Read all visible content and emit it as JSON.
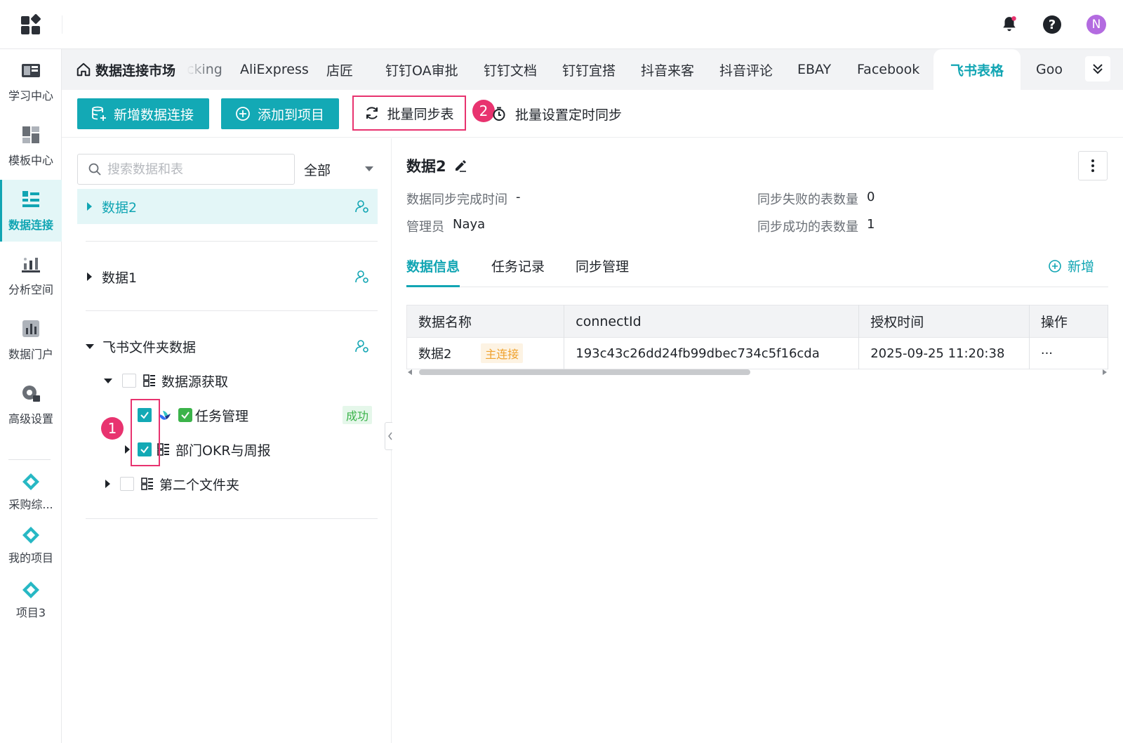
{
  "colors": {
    "accent": "#13a9b5",
    "highlight": "#e8336f",
    "success": "#3bb34a",
    "warning": "#f0a22e"
  },
  "topbar": {
    "icons": [
      "apps-grid-icon",
      "bell-icon",
      "help-icon"
    ],
    "avatar_letter": "N"
  },
  "sidebar": {
    "items": [
      {
        "label": "学习中心",
        "icon": "book-icon"
      },
      {
        "label": "模板中心",
        "icon": "template-icon"
      },
      {
        "label": "数据连接",
        "icon": "data-connect-icon",
        "active": true
      },
      {
        "label": "分析空间",
        "icon": "analysis-icon"
      },
      {
        "label": "数据门户",
        "icon": "bar-chart-icon"
      },
      {
        "label": "高级设置",
        "icon": "gear-icon"
      }
    ],
    "projects": [
      {
        "label": "采购综...",
        "icon": "project-diamond-icon"
      },
      {
        "label": "我的项目",
        "icon": "project-diamond-icon"
      },
      {
        "label": "项目3",
        "icon": "project-diamond-icon"
      }
    ]
  },
  "tabs": {
    "home": "数据连接市场",
    "items": [
      "cking",
      "AliExpress",
      "店匠",
      "钉钉OA审批",
      "钉钉文档",
      "钉钉宜搭",
      "抖音来客",
      "抖音评论",
      "EBAY",
      "Facebook",
      "飞书表格",
      "Goo"
    ],
    "active": "飞书表格"
  },
  "toolbar": {
    "add_connection": "新增数据连接",
    "add_to_project": "添加到项目",
    "batch_sync": "批量同步表",
    "batch_schedule": "批量设置定时同步",
    "step_badges": [
      "1",
      "2"
    ]
  },
  "tree": {
    "search_placeholder": "搜索数据和表",
    "filter": "全部",
    "items": {
      "data2": "数据2",
      "data1": "数据1",
      "feishu_folder": "飞书文件夹数据",
      "source_fetch": "数据源获取",
      "task_mgmt": "任务管理",
      "task_status": "成功",
      "okr": "部门OKR与周报",
      "second_folder": "第二个文件夹"
    }
  },
  "detail": {
    "title": "数据2",
    "sync_time_label": "数据同步完成时间",
    "sync_time_value": "-",
    "admin_label": "管理员",
    "admin_value": "Naya",
    "fail_label": "同步失败的表数量",
    "fail_value": "0",
    "success_label": "同步成功的表数量",
    "success_value": "1",
    "subtabs": [
      "数据信息",
      "任务记录",
      "同步管理"
    ],
    "add_label": "新增",
    "table": {
      "headers": [
        "数据名称",
        "connectId",
        "授权时间",
        "操作"
      ],
      "rows": [
        {
          "name": "数据2",
          "tag": "主连接",
          "connect_id": "193c43c26dd24fb99dbec734c5f16cda",
          "auth_time": "2025-09-25 11:20:38",
          "action": "···"
        }
      ]
    }
  }
}
